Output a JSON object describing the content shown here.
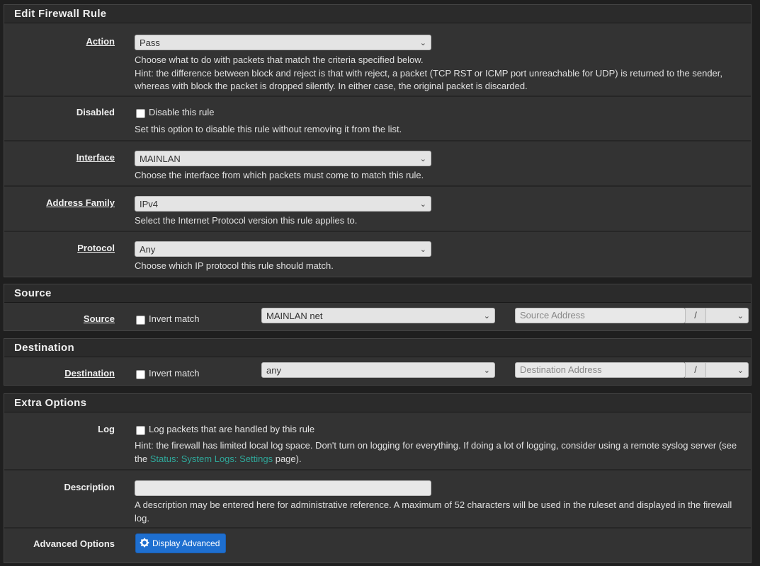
{
  "edit_rule": {
    "title": "Edit Firewall Rule",
    "action": {
      "label": "Action",
      "value": "Pass",
      "help1": "Choose what to do with packets that match the criteria specified below.",
      "help2": "Hint: the difference between block and reject is that with reject, a packet (TCP RST or ICMP port unreachable for UDP) is returned to the sender,",
      "help3": "whereas with block the packet is dropped silently. In either case, the original packet is discarded."
    },
    "disabled": {
      "label": "Disabled",
      "checkbox_label": "Disable this rule",
      "help": "Set this option to disable this rule without removing it from the list."
    },
    "interface": {
      "label": "Interface",
      "value": "MAINLAN",
      "help": "Choose the interface from which packets must come to match this rule."
    },
    "address_family": {
      "label": "Address Family",
      "value": "IPv4",
      "help": "Select the Internet Protocol version this rule applies to."
    },
    "protocol": {
      "label": "Protocol",
      "value": "Any",
      "help": "Choose which IP protocol this rule should match."
    }
  },
  "source": {
    "title": "Source",
    "label": "Source",
    "invert_label": "Invert match",
    "type_value": "MAINLAN net",
    "address_placeholder": "Source Address",
    "slash": "/"
  },
  "destination": {
    "title": "Destination",
    "label": "Destination",
    "invert_label": "Invert match",
    "type_value": "any",
    "address_placeholder": "Destination Address",
    "slash": "/"
  },
  "extra": {
    "title": "Extra Options",
    "log": {
      "label": "Log",
      "checkbox_label": "Log packets that are handled by this rule",
      "help1": "Hint: the firewall has limited local log space. Don't turn on logging for everything. If doing a lot of logging, consider using a remote syslog server (see",
      "help2_pre": "the ",
      "help2_link": "Status: System Logs: Settings",
      "help2_post": " page)."
    },
    "description": {
      "label": "Description",
      "value": "",
      "help1": "A description may be entered here for administrative reference. A maximum of 52 characters will be used in the ruleset and displayed in the firewall",
      "help2": "log."
    },
    "advanced": {
      "label": "Advanced Options",
      "button_label": "Display Advanced"
    }
  },
  "colors": {
    "accent_link": "#2fa89a",
    "button": "#1e6fd0"
  }
}
